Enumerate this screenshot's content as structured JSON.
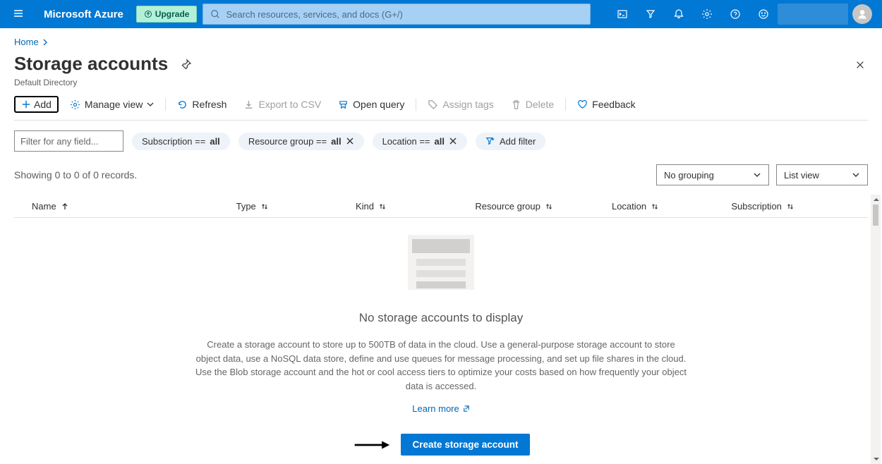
{
  "topbar": {
    "brand": "Microsoft Azure",
    "upgrade_label": "Upgrade",
    "search_placeholder": "Search resources, services, and docs (G+/)"
  },
  "breadcrumb": {
    "home": "Home"
  },
  "page": {
    "title": "Storage accounts",
    "subtitle": "Default Directory"
  },
  "toolbar": {
    "add": "Add",
    "manage_view": "Manage view",
    "refresh": "Refresh",
    "export_csv": "Export to CSV",
    "open_query": "Open query",
    "assign_tags": "Assign tags",
    "delete": "Delete",
    "feedback": "Feedback"
  },
  "filters": {
    "input_placeholder": "Filter for any field...",
    "subscription_prefix": "Subscription == ",
    "resourcegroup_prefix": "Resource group == ",
    "location_prefix": "Location == ",
    "value_all": "all",
    "add_filter": "Add filter"
  },
  "records": {
    "summary": "Showing 0 to 0 of 0 records.",
    "grouping_selected": "No grouping",
    "view_selected": "List view"
  },
  "columns": {
    "name": "Name",
    "type": "Type",
    "kind": "Kind",
    "resource_group": "Resource group",
    "location": "Location",
    "subscription": "Subscription"
  },
  "empty": {
    "title": "No storage accounts to display",
    "description": "Create a storage account to store up to 500TB of data in the cloud. Use a general-purpose storage account to store object data, use a NoSQL data store, define and use queues for message processing, and set up file shares in the cloud. Use the Blob storage account and the hot or cool access tiers to optimize your costs based on how frequently your object data is accessed.",
    "learn_more": "Learn more",
    "create_button": "Create storage account"
  }
}
